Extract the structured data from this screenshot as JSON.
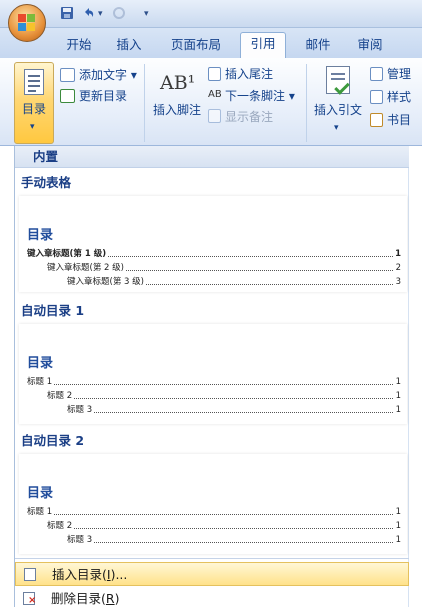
{
  "tabs": [
    {
      "label": "开始",
      "active": false
    },
    {
      "label": "插入",
      "active": false
    },
    {
      "label": "页面布局",
      "active": false
    },
    {
      "label": "引用",
      "active": true
    },
    {
      "label": "邮件",
      "active": false
    },
    {
      "label": "审阅",
      "active": false
    }
  ],
  "ribbon": {
    "toc_button": "目录",
    "add_text": "添加文字",
    "update_toc": "更新目录",
    "insert_footnote": "插入脚注",
    "footnote_glyph": "AB¹",
    "insert_endnote": "插入尾注",
    "next_footnote": "下一条脚注",
    "show_notes": "显示备注",
    "insert_citation": "插入引文",
    "manage": "管理",
    "style": "样式",
    "bibliography": "书目"
  },
  "gallery": {
    "builtin_header": "内置",
    "manual": {
      "name": "手动表格",
      "title": "目录",
      "entries": [
        {
          "text": "键入章标题(第 1 级)",
          "page": "1",
          "bold": true
        },
        {
          "text": "键入章标题(第 2 级)",
          "page": "2",
          "bold": false
        },
        {
          "text": "键入章标题(第 3 级)",
          "page": "3",
          "bold": false
        }
      ]
    },
    "auto1": {
      "name": "自动目录 1",
      "title": "目录",
      "entries": [
        {
          "text": "标题 1",
          "page": "1"
        },
        {
          "text": "标题 2",
          "page": "1"
        },
        {
          "text": "标题 3",
          "page": "1"
        }
      ]
    },
    "auto2": {
      "name": "自动目录 2",
      "title": "目录",
      "entries": [
        {
          "text": "标题 1",
          "page": "1"
        },
        {
          "text": "标题 2",
          "page": "1"
        },
        {
          "text": "标题 3",
          "page": "1"
        }
      ]
    }
  },
  "menu": {
    "insert_toc": {
      "prefix": "插入目录(",
      "key": "I",
      "suffix": ")..."
    },
    "delete_toc": {
      "prefix": "删除目录(",
      "key": "R",
      "suffix": ")"
    }
  },
  "colors": {
    "accent": "#15428b",
    "hover": "#ffe28a",
    "heading": "#1b3f86"
  }
}
